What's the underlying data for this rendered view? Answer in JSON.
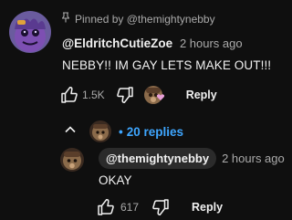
{
  "pinned": {
    "text": "Pinned by @themightynebby"
  },
  "comment": {
    "author": "@EldritchCutieZoe",
    "time": "2 hours ago",
    "text": "NEBBY!! IM GAY LETS MAKE OUT!!!",
    "likes": "1.5K",
    "reply_label": "Reply"
  },
  "replies_toggle": {
    "label": "20 replies"
  },
  "reply": {
    "author": "@themightynebby",
    "time": "2 hours ago",
    "text": "OKAY",
    "likes": "617",
    "reply_label": "Reply"
  },
  "colors": {
    "accent": "#3ea6ff",
    "background": "#0f0f0f",
    "text": "#f1f1f1",
    "muted": "#aaaaaa",
    "heart": "#e8a0d8"
  }
}
